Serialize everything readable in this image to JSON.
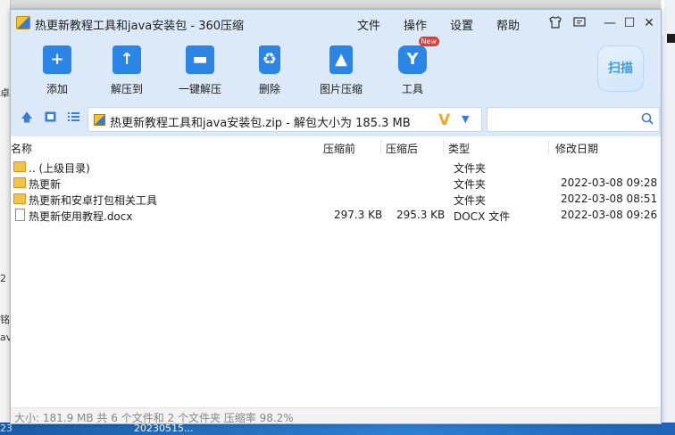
{
  "window": {
    "title": "热更新教程工具和java安装包 - 360压缩"
  },
  "menu": {
    "items": [
      "文件",
      "操作",
      "设置",
      "帮助"
    ]
  },
  "window_controls": {
    "skin_icon": "shirt-icon",
    "feedback_icon": "message-icon",
    "minimize": "—",
    "maximize": "☐",
    "close": "✕"
  },
  "toolbar": {
    "add": "添加",
    "extract_to": "解压到",
    "one_click_extract": "一键解压",
    "delete": "删除",
    "image_compress": "图片压缩",
    "tools": "工具",
    "new_badge": "New",
    "scan": "扫描"
  },
  "address": {
    "path": "热更新教程工具和java安装包.zip - 解包大小为 185.3 MB",
    "v_mark": "V",
    "search_placeholder": ""
  },
  "columns": {
    "name": "名称",
    "compressed": "压缩前",
    "packed": "压缩后",
    "type": "类型",
    "modified": "修改日期"
  },
  "files": [
    {
      "name": ".. (上级目录)",
      "before": "",
      "after": "",
      "type": "文件夹",
      "date": "",
      "icon": "folder"
    },
    {
      "name": "热更新",
      "before": "",
      "after": "",
      "type": "文件夹",
      "date": "2022-03-08 09:28",
      "icon": "folder"
    },
    {
      "name": "热更新和安卓打包相关工具",
      "before": "",
      "after": "",
      "type": "文件夹",
      "date": "2022-03-08 08:51",
      "icon": "folder"
    },
    {
      "name": "热更新使用教程.docx",
      "before": "297.3 KB",
      "after": "295.3 KB",
      "type": "DOCX 文件",
      "date": "2022-03-08 09:26",
      "icon": "document"
    }
  ],
  "status": {
    "text": "大小: 181.9 MB 共 6 个文件和 2 个文件夹 压缩率 98.2%"
  },
  "background": {
    "left_fragments": [
      "卓",
      "2",
      "铭",
      "av"
    ],
    "taskbar_time": "20230515...",
    "taskbar_left": "23"
  },
  "colors": {
    "accent": "#2b85e4",
    "title_bg": "#dbe9f8",
    "folder": "#f4c24a"
  }
}
